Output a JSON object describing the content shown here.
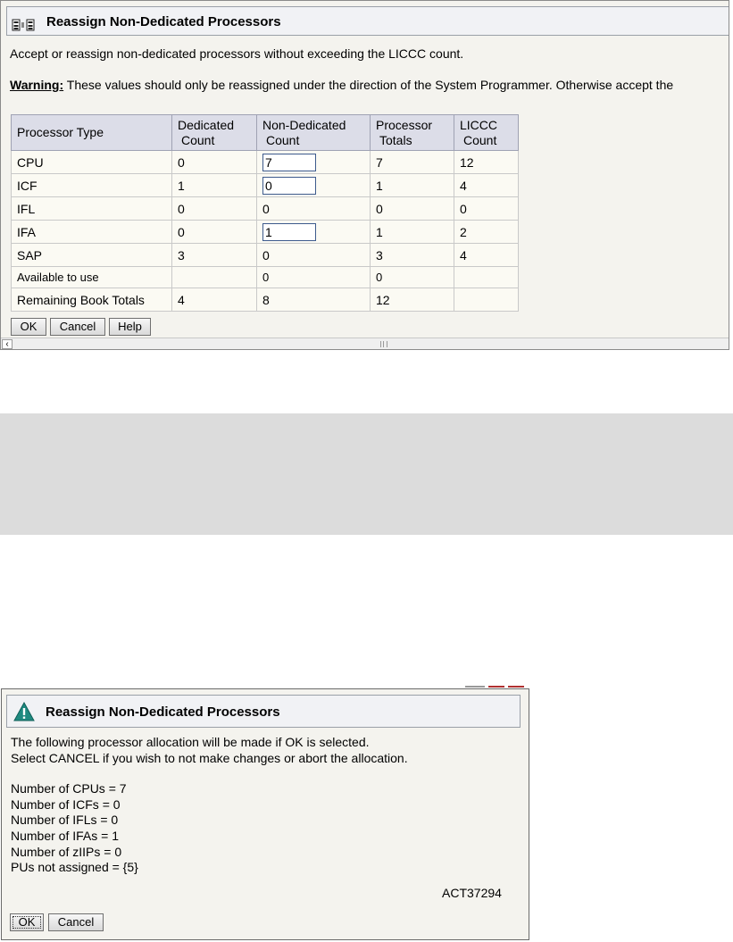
{
  "top_dialog": {
    "title": "Reassign Non-Dedicated Processors",
    "description": "Accept or reassign non-dedicated processors without exceeding the LICCC count.",
    "warning_label": "Warning:",
    "warning_text": " These values should only be reassigned under the direction of the System Programmer. Otherwise accept the",
    "table": {
      "headers": [
        {
          "line1": "Processor Type",
          "line2": ""
        },
        {
          "line1": "Dedicated",
          "line2": "Count"
        },
        {
          "line1": "Non-Dedicated",
          "line2": "Count"
        },
        {
          "line1": "Processor",
          "line2": "Totals"
        },
        {
          "line1": "LICCC",
          "line2": "Count"
        }
      ],
      "rows": [
        {
          "type": "CPU",
          "dedicated": "0",
          "non_dedicated": "7",
          "totals": "7",
          "liccc": "12"
        },
        {
          "type": "ICF",
          "dedicated": "1",
          "non_dedicated": "0",
          "totals": "1",
          "liccc": "4"
        },
        {
          "type": "IFL",
          "dedicated": "0",
          "non_dedicated": "0",
          "totals": "0",
          "liccc": "0"
        },
        {
          "type": "IFA",
          "dedicated": "0",
          "non_dedicated": "1",
          "totals": "1",
          "liccc": "2"
        },
        {
          "type": "SAP",
          "dedicated": "3",
          "non_dedicated": "0",
          "totals": "3",
          "liccc": "4"
        },
        {
          "type": "Available to use",
          "dedicated": "",
          "non_dedicated": "0",
          "totals": "0",
          "liccc": ""
        },
        {
          "type": "Remaining Book Totals",
          "dedicated": "4",
          "non_dedicated": "8",
          "totals": "12",
          "liccc": ""
        }
      ]
    },
    "buttons": {
      "ok": "OK",
      "cancel": "Cancel",
      "help": "Help"
    },
    "scrollbar_grip": "III"
  },
  "confirm_dialog": {
    "title": "Reassign Non-Dedicated Processors",
    "line1": "The following processor allocation will be made if OK is selected.",
    "line2": "Select CANCEL if you wish to not make changes or abort the allocation.",
    "allocations": [
      "Number of CPUs = 7",
      "Number of ICFs = 0",
      "Number of IFLs = 0",
      "Number of IFAs = 1",
      "Number of zIIPs = 0",
      "PUs not assigned = {5}"
    ],
    "message_code": "ACT37294",
    "buttons": {
      "ok": "OK",
      "cancel": "Cancel"
    }
  },
  "colors": {
    "panel_bg": "#f4f3ee",
    "header_bg": "#f1f2f5",
    "table_header_bg": "#dcdde8",
    "warning_icon": "#1f8a80",
    "grey_band": "#dcdcdc"
  },
  "icons": {
    "top_header_icon": "task-icon",
    "confirm_header_icon": "warning-triangle-icon"
  }
}
